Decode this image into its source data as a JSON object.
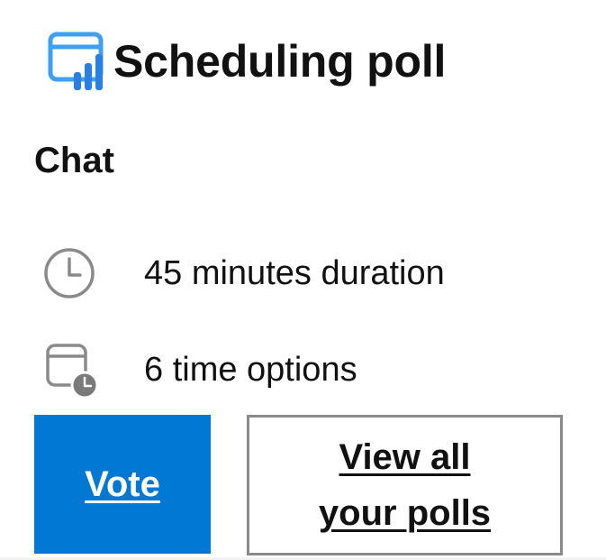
{
  "card": {
    "title": "Scheduling poll",
    "subtitle": "Chat",
    "app_icon": "calendar-chart-icon",
    "accent_color": "#0078d4"
  },
  "details": [
    {
      "icon": "clock-icon",
      "text": "45 minutes duration"
    },
    {
      "icon": "calendar-clock-icon",
      "text": "6 time options"
    }
  ],
  "actions": {
    "vote_label": "Vote",
    "view_all_line1": "View all",
    "view_all_line2": "your polls"
  }
}
